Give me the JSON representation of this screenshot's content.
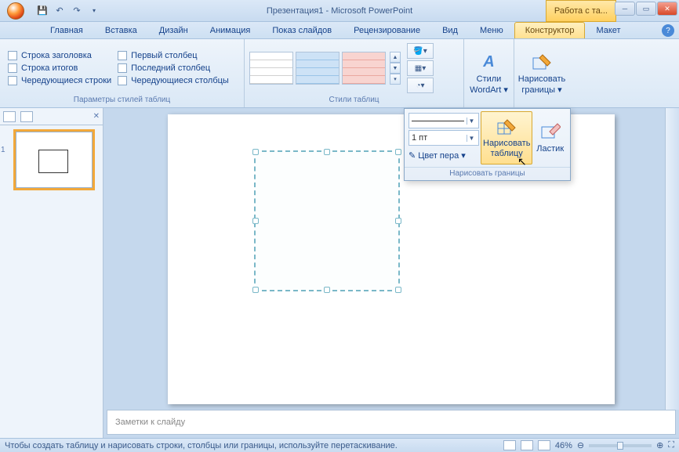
{
  "titlebar": {
    "title": "Презентация1 - Microsoft PowerPoint",
    "contextual": "Работа с та..."
  },
  "tabs": {
    "items": [
      "Главная",
      "Вставка",
      "Дизайн",
      "Анимация",
      "Показ слайдов",
      "Рецензирование",
      "Вид",
      "Меню",
      "Конструктор",
      "Макет"
    ],
    "active_index": 8
  },
  "ribbon": {
    "group_options": {
      "title": "Параметры стилей таблиц",
      "col1": [
        "Строка заголовка",
        "Строка итогов",
        "Чередующиеся строки"
      ],
      "col2": [
        "Первый столбец",
        "Последний столбец",
        "Чередующиеся столбцы"
      ]
    },
    "group_styles": {
      "title": "Стили таблиц"
    },
    "group_wordart": {
      "title": "Стили WordArt ▾",
      "label": "Стили\nWordArt ▾"
    },
    "group_draw": {
      "label": "Нарисовать\nграницы ▾"
    }
  },
  "popup": {
    "weight": "1 пт",
    "pen_color_label": "Цвет пера ▾",
    "draw_table": "Нарисовать\nтаблицу",
    "eraser": "Ластик",
    "title": "Нарисовать границы"
  },
  "slides_panel": {
    "thumb_number": "1"
  },
  "notes": {
    "placeholder": "Заметки к слайду"
  },
  "statusbar": {
    "hint": "Чтобы создать таблицу и нарисовать строки, столбцы или границы, используйте перетаскивание.",
    "zoom": "46%"
  }
}
